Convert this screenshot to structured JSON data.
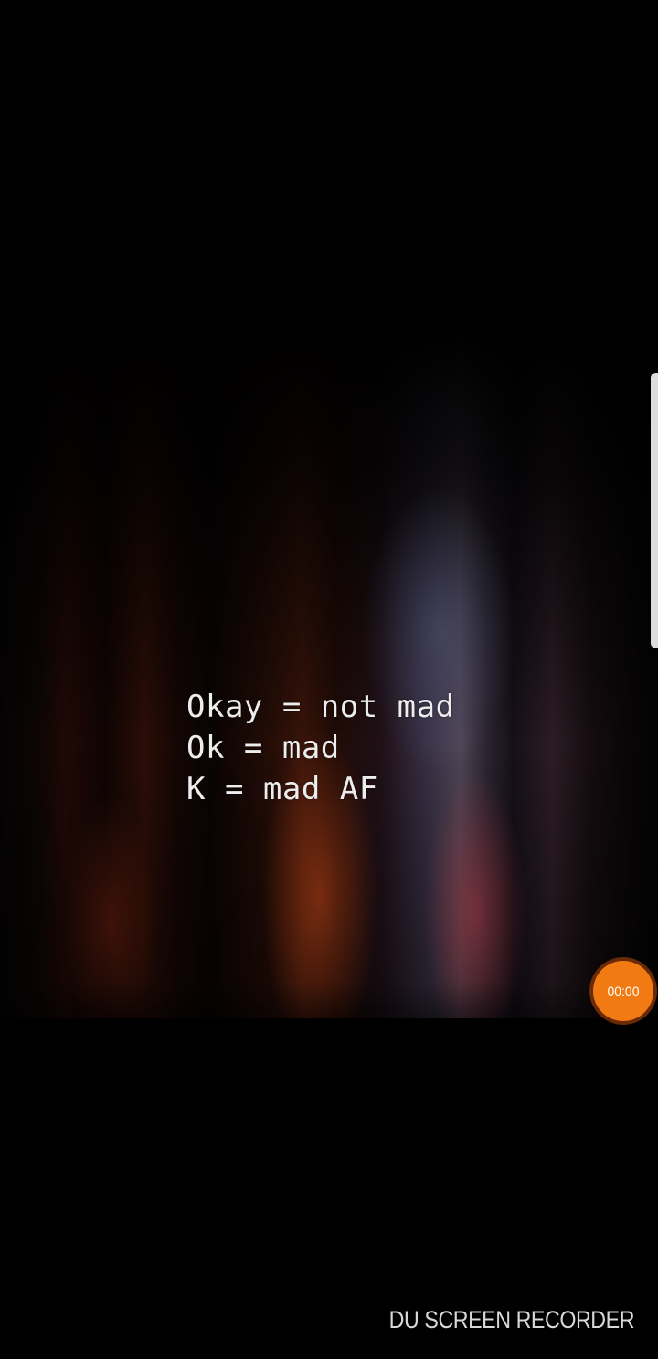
{
  "quote": {
    "lines": [
      "Okay = not mad",
      "Ok = mad",
      "K = mad AF"
    ]
  },
  "recorder": {
    "timer": "00:00",
    "accent_color": "#f27a12",
    "watermark": "DU SCREEN RECORDER"
  },
  "colors": {
    "background": "#000000",
    "quote_text": "#ededed"
  }
}
